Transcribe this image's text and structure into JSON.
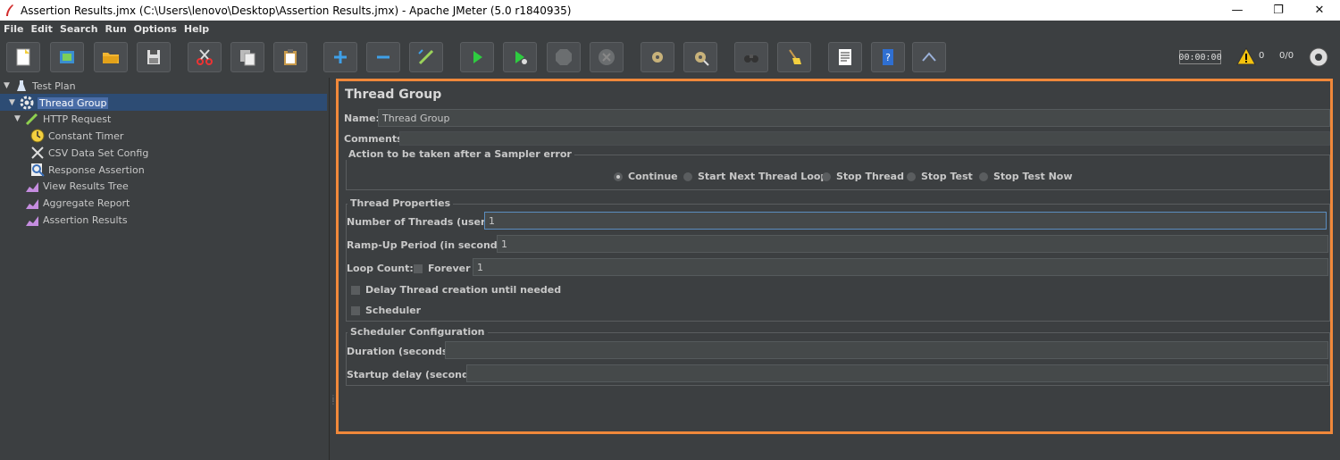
{
  "window": {
    "title": "Assertion Results.jmx (C:\\Users\\lenovo\\Desktop\\Assertion Results.jmx) - Apache JMeter (5.0 r1840935)",
    "minimize": "—",
    "maximize": "❐",
    "close": "✕"
  },
  "menu": [
    "File",
    "Edit",
    "Search",
    "Run",
    "Options",
    "Help"
  ],
  "toolbar": {
    "timer": "00:00:00",
    "warnings": "0",
    "threads": "0/0"
  },
  "tree": [
    {
      "label": "Test Plan",
      "icon": "test-plan-icon"
    },
    {
      "label": "Thread Group",
      "icon": "gear-icon"
    },
    {
      "label": "HTTP Request",
      "icon": "pipette-icon"
    },
    {
      "label": "Constant Timer",
      "icon": "timer-icon"
    },
    {
      "label": "CSV Data Set Config",
      "icon": "scissors-config-icon"
    },
    {
      "label": "Response Assertion",
      "icon": "magnifier-icon"
    },
    {
      "label": "View Results Tree",
      "icon": "chart-icon"
    },
    {
      "label": "Aggregate Report",
      "icon": "chart-icon"
    },
    {
      "label": "Assertion Results",
      "icon": "chart-icon"
    }
  ],
  "panel": {
    "title": "Thread Group",
    "name_label": "Name:",
    "name_value": "Thread Group",
    "comments_label": "Comments:",
    "sampler_error": {
      "legend": "Action to be taken after a Sampler error",
      "options": [
        "Continue",
        "Start Next Thread Loop",
        "Stop Thread",
        "Stop Test",
        "Stop Test Now"
      ],
      "selected": "Continue"
    },
    "thread_props": {
      "legend": "Thread Properties",
      "threads_label": "Number of Threads (users):",
      "threads_value": "1",
      "rampup_label": "Ramp-Up Period (in seconds):",
      "rampup_value": "1",
      "loop_label": "Loop Count:",
      "forever_label": "Forever",
      "loop_value": "1",
      "delay_label": "Delay Thread creation until needed",
      "scheduler_label": "Scheduler"
    },
    "scheduler_config": {
      "legend": "Scheduler Configuration",
      "duration_label": "Duration (seconds)",
      "startup_label": "Startup delay (seconds)"
    }
  },
  "colors": {
    "highlight": "#f0883a",
    "selection": "#2d4c74"
  }
}
